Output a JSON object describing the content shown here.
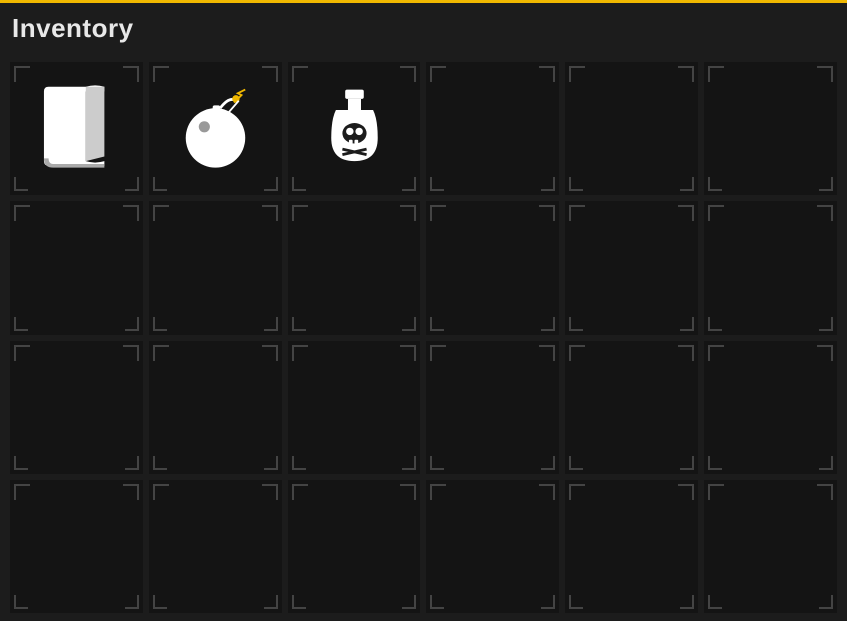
{
  "header": {
    "title": "Inventory",
    "border_color": "#f0b800"
  },
  "grid": {
    "columns": 6,
    "rows": 4,
    "slots": [
      {
        "id": 0,
        "icon": "book"
      },
      {
        "id": 1,
        "icon": "bomb"
      },
      {
        "id": 2,
        "icon": "poison"
      },
      {
        "id": 3,
        "icon": "empty"
      },
      {
        "id": 4,
        "icon": "empty"
      },
      {
        "id": 5,
        "icon": "empty"
      },
      {
        "id": 6,
        "icon": "empty"
      },
      {
        "id": 7,
        "icon": "empty"
      },
      {
        "id": 8,
        "icon": "empty"
      },
      {
        "id": 9,
        "icon": "empty"
      },
      {
        "id": 10,
        "icon": "empty"
      },
      {
        "id": 11,
        "icon": "empty"
      },
      {
        "id": 12,
        "icon": "empty"
      },
      {
        "id": 13,
        "icon": "empty"
      },
      {
        "id": 14,
        "icon": "empty"
      },
      {
        "id": 15,
        "icon": "empty"
      },
      {
        "id": 16,
        "icon": "empty"
      },
      {
        "id": 17,
        "icon": "empty"
      },
      {
        "id": 18,
        "icon": "empty"
      },
      {
        "id": 19,
        "icon": "empty"
      },
      {
        "id": 20,
        "icon": "empty"
      },
      {
        "id": 21,
        "icon": "empty"
      },
      {
        "id": 22,
        "icon": "empty"
      },
      {
        "id": 23,
        "icon": "empty"
      }
    ]
  }
}
